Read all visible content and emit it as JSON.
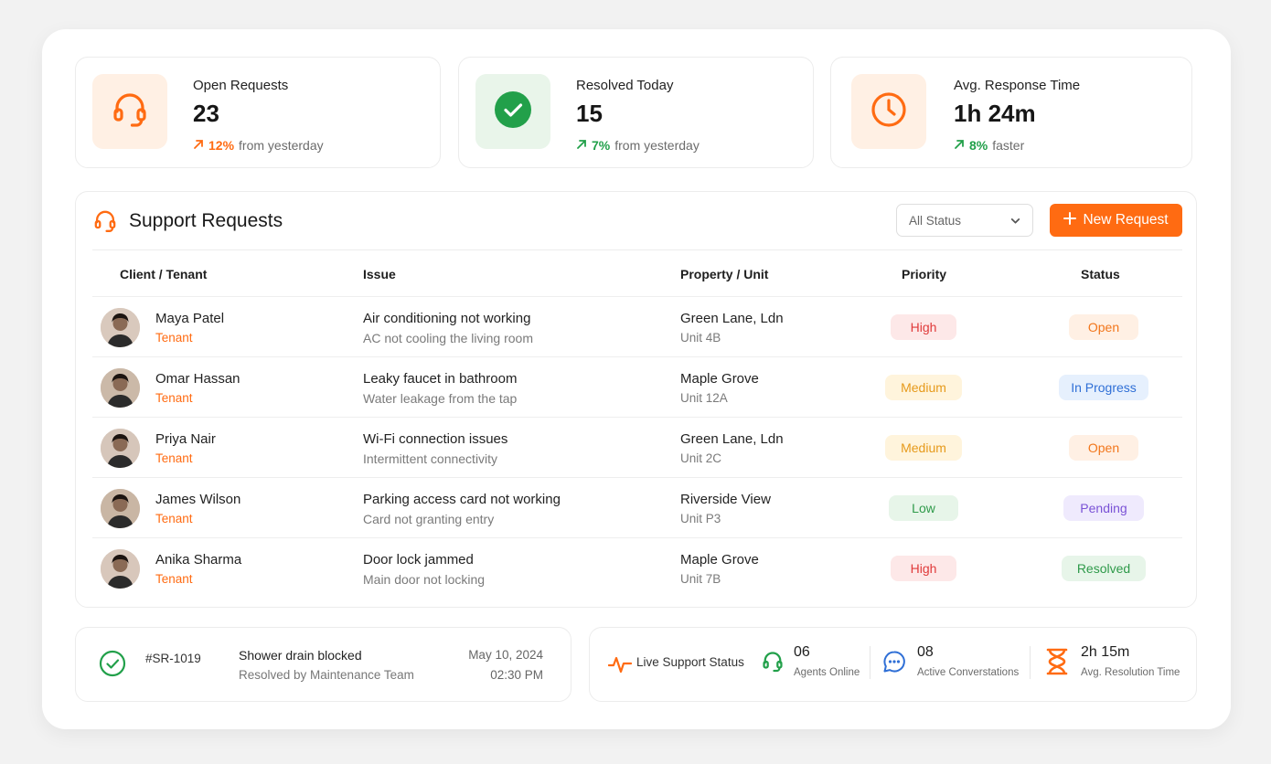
{
  "colors": {
    "accent": "#ff6b12",
    "success": "#22a04a",
    "page_bg": "#f2f2f2"
  },
  "stats": [
    {
      "title": "Open Requests",
      "value": "23",
      "trend_pct": "12%",
      "trend_text": "from yesterday",
      "icon": "headset-icon",
      "trend_color": "#ff6b12"
    },
    {
      "title": "Resolved Today",
      "value": "15",
      "trend_pct": "7%",
      "trend_text": "from yesterday",
      "icon": "check-circle-icon",
      "trend_color": "#22a04a"
    },
    {
      "title": "Avg. Response Time",
      "value": "1h 24m",
      "trend_pct": "8%",
      "trend_text": "faster",
      "icon": "clock-icon",
      "trend_color": "#22a04a"
    }
  ],
  "requests": {
    "title": "Support Requests",
    "status_filter": "All Status",
    "new_button": "New Request",
    "columns": [
      "Client / Tenant",
      "Issue",
      "Property / Unit",
      "Priority",
      "Status"
    ],
    "rows": [
      {
        "name": "Maya Patel",
        "role": "Tenant",
        "issue": "Air conditioning not working",
        "issue_detail": "AC not cooling the living room",
        "property": "Green Lane, Ldn",
        "unit": "Unit 4B",
        "priority": "High",
        "status": "Open"
      },
      {
        "name": "Omar Hassan",
        "role": "Tenant",
        "issue": "Leaky faucet in bathroom",
        "issue_detail": "Water leakage from the tap",
        "property": "Maple Grove",
        "unit": "Unit 12A",
        "priority": "Medium",
        "status": "In Progress"
      },
      {
        "name": "Priya Nair",
        "role": "Tenant",
        "issue": "Wi-Fi connection issues",
        "issue_detail": "Intermittent connectivity",
        "property": "Green Lane, Ldn",
        "unit": "Unit 2C",
        "priority": "Medium",
        "status": "Open"
      },
      {
        "name": "James Wilson",
        "role": "Tenant",
        "issue": "Parking access card not working",
        "issue_detail": "Card not granting entry",
        "property": "Riverside View",
        "unit": "Unit P3",
        "priority": "Low",
        "status": "Pending"
      },
      {
        "name": "Anika Sharma",
        "role": "Tenant",
        "issue": "Door lock jammed",
        "issue_detail": "Main door not locking",
        "property": "Maple Grove",
        "unit": "Unit 7B",
        "priority": "High",
        "status": "Resolved"
      }
    ]
  },
  "priority_styles": {
    "High": {
      "bg": "#fde8e8",
      "fg": "#e03a3a"
    },
    "Medium": {
      "bg": "#fff4dc",
      "fg": "#e69a1b"
    },
    "Low": {
      "bg": "#e7f5e9",
      "fg": "#2f9a4a"
    }
  },
  "status_styles": {
    "Open": {
      "bg": "#fff0e4",
      "fg": "#f2761b"
    },
    "In Progress": {
      "bg": "#e6f0fd",
      "fg": "#2f6fd6"
    },
    "Pending": {
      "bg": "#efeafd",
      "fg": "#7a52d6"
    },
    "Resolved": {
      "bg": "#e7f5e9",
      "fg": "#2f9a4a"
    }
  },
  "recent": {
    "id": "#SR-1019",
    "title": "Shower drain blocked",
    "subtitle": "Resolved by Maintenance Team",
    "date": "May 10, 2024",
    "time": "02:30 PM"
  },
  "live": {
    "label": "Live Support Status",
    "metrics": [
      {
        "value": "06",
        "label": "Agents Online",
        "icon": "headset-icon"
      },
      {
        "value": "08",
        "label": "Active Converstations",
        "icon": "chat-bubble-icon"
      },
      {
        "value": "2h 15m",
        "label": "Avg. Resolution Time",
        "icon": "hourglass-icon"
      }
    ]
  }
}
